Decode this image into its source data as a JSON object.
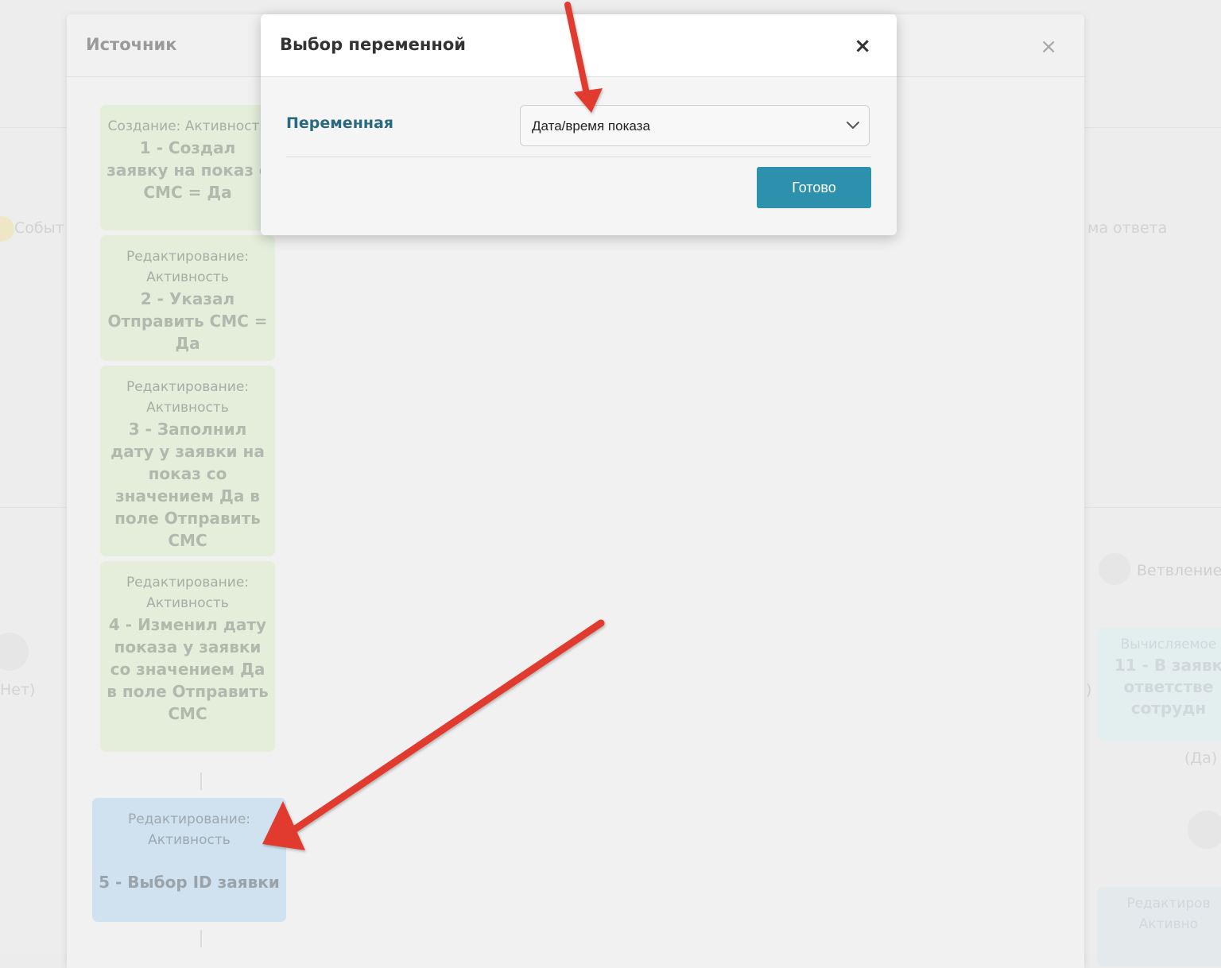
{
  "background": {
    "left_texts": [
      "Событ",
      "Нет)"
    ],
    "right_texts": [
      "ма ответа",
      "Ветвление",
      ")",
      "(Да)"
    ],
    "right_nodes": [
      {
        "kind": "Вычисляемое",
        "name": "11 - В заявк ответстве сотрудн"
      },
      {
        "kind": "Редактиров",
        "name": "Активно"
      }
    ]
  },
  "source_modal": {
    "title": "Источник",
    "close_glyph": "×",
    "cards": [
      {
        "kind": "Создание: Активность",
        "name": "1 - Создал заявку на показ с СМС = Да"
      },
      {
        "kind": "Редактирование: Активность",
        "name": "2 - Указал Отправить СМС = Да"
      },
      {
        "kind": "Редактирование: Активность",
        "name": "3 - Заполнил дату у заявки на показ со значением Да в поле Отправить СМС"
      },
      {
        "kind": "Редактирование: Активность",
        "name": "4 - Изменил дату показа у заявки со значением Да в поле Отправить СМС"
      },
      {
        "kind": "Редактирование: Активность",
        "name": "5 - Выбор ID заявки"
      }
    ]
  },
  "variable_dialog": {
    "title": "Выбор переменной",
    "close_glyph": "×",
    "field_label": "Переменная",
    "selected_value": "Дата/время показа",
    "done_label": "Готово",
    "accent_color": "#2d90ad"
  },
  "annotations": {
    "arrow_color": "#e03a2e"
  }
}
